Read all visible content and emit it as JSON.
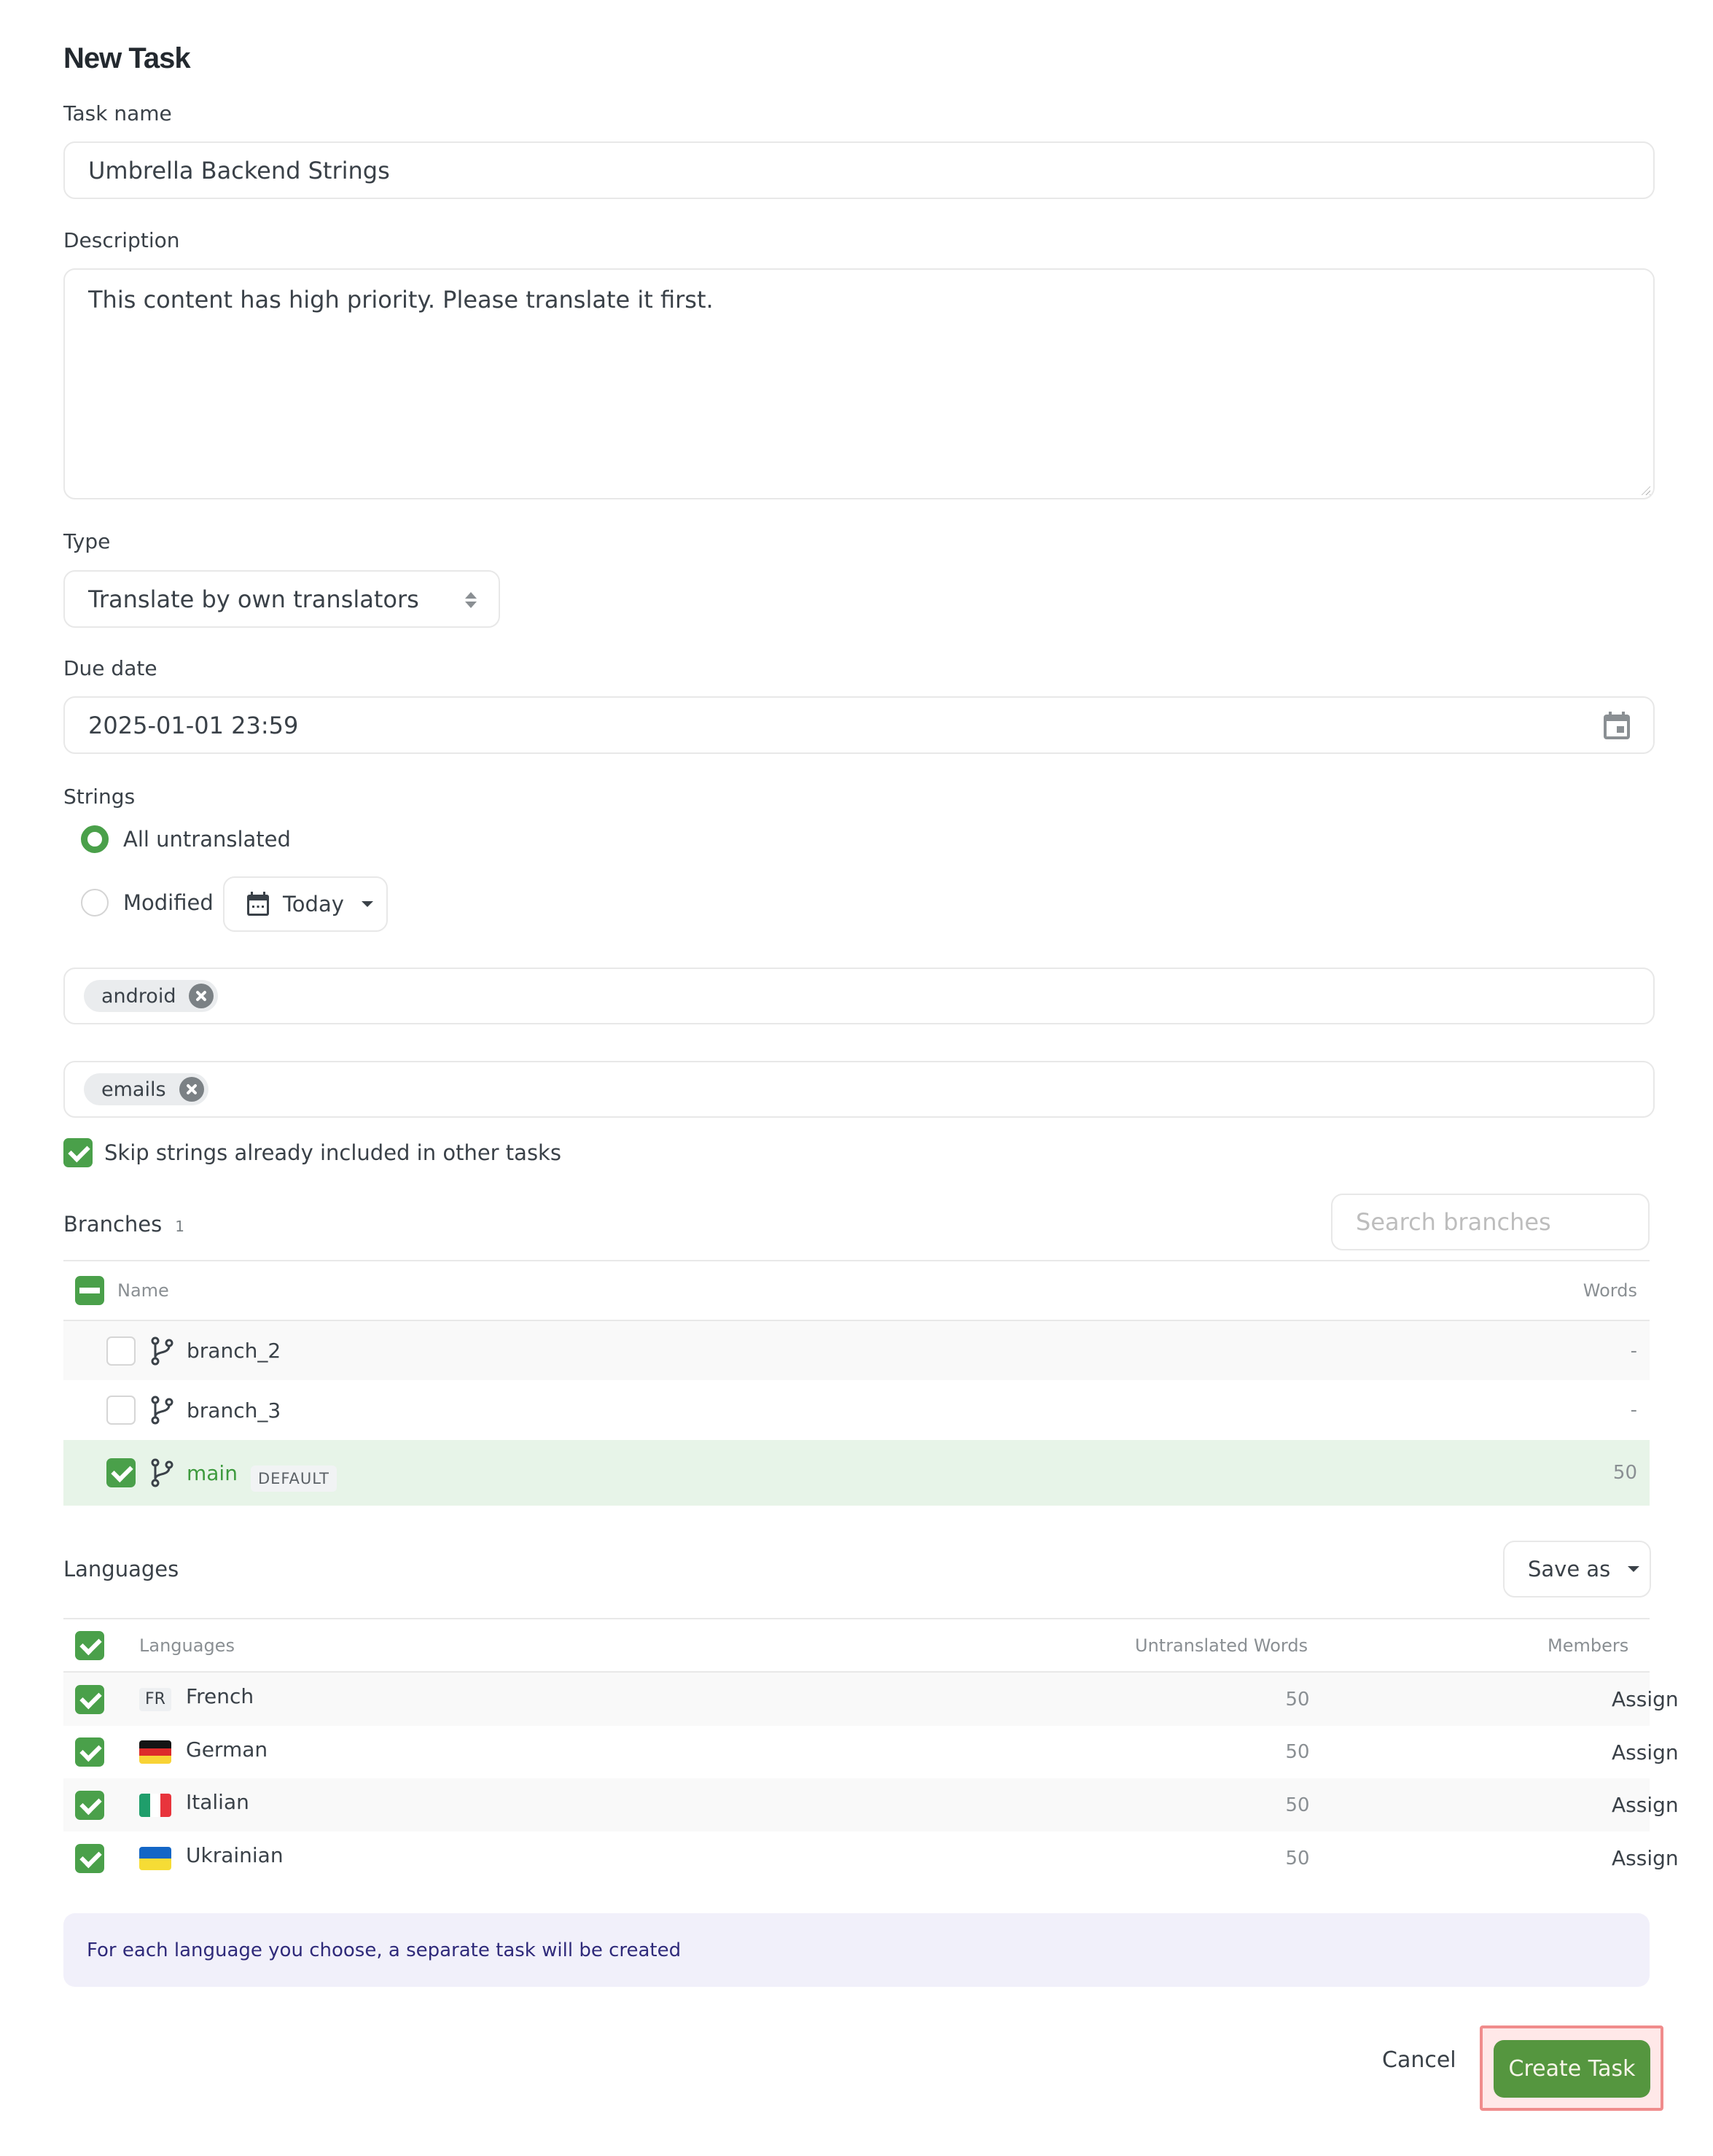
{
  "page": {
    "title": "New Task"
  },
  "task_name": {
    "label": "Task name",
    "value": "Umbrella Backend Strings"
  },
  "description": {
    "label": "Description",
    "value": "This content has high priority. Please translate it first."
  },
  "type": {
    "label": "Type",
    "selected": "Translate by own translators"
  },
  "due_date": {
    "label": "Due date",
    "value": "2025-01-01 23:59"
  },
  "strings": {
    "label": "Strings",
    "options": [
      {
        "label": "All untranslated",
        "selected": true
      },
      {
        "label": "Modified",
        "selected": false
      }
    ],
    "modified_range": "Today",
    "label_filters": [
      "android"
    ],
    "exclude_labels": [
      "emails"
    ],
    "skip_label": "Skip strings already included in other tasks",
    "skip_checked": true
  },
  "branches": {
    "title": "Branches",
    "count": "1",
    "search_placeholder": "Search branches",
    "columns": {
      "name": "Name",
      "words": "Words"
    },
    "rows": [
      {
        "name": "branch_2",
        "words": "-",
        "checked": false,
        "badge": ""
      },
      {
        "name": "branch_3",
        "words": "-",
        "checked": false,
        "badge": ""
      },
      {
        "name": "main",
        "words": "50",
        "checked": true,
        "badge": "DEFAULT"
      }
    ]
  },
  "languages": {
    "title": "Languages",
    "save_as_label": "Save as",
    "columns": {
      "language": "Languages",
      "untranslated": "Untranslated Words",
      "members": "Members"
    },
    "rows": [
      {
        "code": "FR",
        "name": "French",
        "untranslated": "50",
        "action": "Assign",
        "checked": true
      },
      {
        "code": "DE",
        "name": "German",
        "untranslated": "50",
        "action": "Assign",
        "checked": true
      },
      {
        "code": "IT",
        "name": "Italian",
        "untranslated": "50",
        "action": "Assign",
        "checked": true
      },
      {
        "code": "UA",
        "name": "Ukrainian",
        "untranslated": "50",
        "action": "Assign",
        "checked": true
      }
    ]
  },
  "info_message": "For each language you choose, a separate task will be created",
  "footer": {
    "cancel_label": "Cancel",
    "create_label": "Create Task"
  },
  "colors": {
    "accent": "#4aa04a",
    "primary_button": "#55963f",
    "selected_row": "#e7f4e8",
    "info_bg": "#f1f0fa",
    "info_text": "#2f2a7a",
    "highlight_outline": "#f08c8c"
  }
}
